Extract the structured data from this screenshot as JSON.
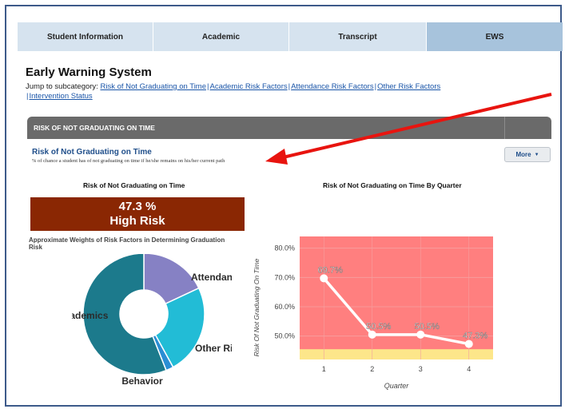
{
  "tabs": [
    {
      "label": "Student Information",
      "active": false
    },
    {
      "label": "Academic",
      "active": false
    },
    {
      "label": "Transcript",
      "active": false
    },
    {
      "label": "EWS",
      "active": true
    }
  ],
  "page": {
    "title": "Early Warning System",
    "jump_prefix": "Jump to subcategory:",
    "jump_links": [
      "Risk of Not Graduating on Time",
      "Academic Risk Factors",
      "Attendance Risk Factors",
      "Other Risk Factors",
      "Intervention Status"
    ]
  },
  "section": {
    "header": "RISK OF NOT GRADUATING ON TIME",
    "subtitle": "Risk of Not Graduating on Time",
    "description": "% of chance a student has of not graduating on time if he/she remains on his/her current path",
    "more_label": "More"
  },
  "risk_panel": {
    "title": "Risk of Not Graduating on Time",
    "percent": "47.3 %",
    "level": "High Risk",
    "color": "#8a2703"
  },
  "donut_panel": {
    "title": "Approximate Weights of Risk Factors in Determining Graduation Risk"
  },
  "line_panel": {
    "title": "Risk of Not Graduating on Time By Quarter"
  },
  "chart_data": [
    {
      "type": "pie",
      "title": "Approximate Weights of Risk Factors in Determining Graduation Risk",
      "slices": [
        {
          "label": "Attendance",
          "value": 18,
          "color": "#8681c4"
        },
        {
          "label": "Other Risks",
          "value": 24,
          "color": "#22bcd6"
        },
        {
          "label": "Behavior",
          "value": 2,
          "color": "#2a8ed4"
        },
        {
          "label": "Academics",
          "value": 56,
          "color": "#1c7a8c"
        }
      ]
    },
    {
      "type": "line",
      "title": "Risk of Not Graduating on Time By Quarter",
      "xlabel": "Quarter",
      "ylabel": "Risk Of Not Graduating On Time",
      "x": [
        1,
        2,
        3,
        4
      ],
      "series": [
        {
          "values": [
            69.7,
            50.5,
            50.5,
            47.3
          ]
        }
      ],
      "data_labels": [
        "69.7%",
        "50.5%",
        "50.5%",
        "47.3%"
      ],
      "yticks": [
        "50.0%",
        "60.0%",
        "70.0%",
        "80.0%"
      ],
      "ylim": [
        42,
        84
      ],
      "background_color": "#ff7f7f",
      "band_color": "#fde68a",
      "line_color": "#ffffff"
    }
  ]
}
